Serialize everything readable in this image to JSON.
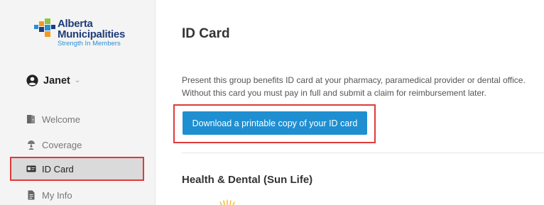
{
  "brand": {
    "line1": "Alberta",
    "line2": "Municipalities",
    "tagline": "Strength In Members",
    "colors": {
      "navy": "#1f3d7a",
      "blue": "#2a8fd6",
      "orange": "#f39a1e",
      "green": "#8cc63f"
    }
  },
  "user": {
    "name": "Janet",
    "icon": "user-circle-icon",
    "caret": "⌄"
  },
  "sidebar": {
    "items": [
      {
        "label": "Welcome",
        "icon": "door-icon",
        "active": false
      },
      {
        "label": "Coverage",
        "icon": "umbrella-person-icon",
        "active": false
      },
      {
        "label": "ID Card",
        "icon": "id-card-icon",
        "active": true
      },
      {
        "label": "My Info",
        "icon": "document-icon",
        "active": false
      }
    ]
  },
  "main": {
    "title": "ID Card",
    "description": "Present this group benefits ID card at your pharmacy, paramedical provider or dental office. Without this card you must pay in full and submit a claim for reimbursement later.",
    "download_button": "Download a printable copy of your ID card",
    "section_title": "Health & Dental (Sun Life)"
  },
  "colors": {
    "accent_button": "#1f8fd1",
    "highlight_border": "#e03a3a",
    "active_nav_bg": "#dadada",
    "sidebar_bg": "#f4f4f4"
  }
}
